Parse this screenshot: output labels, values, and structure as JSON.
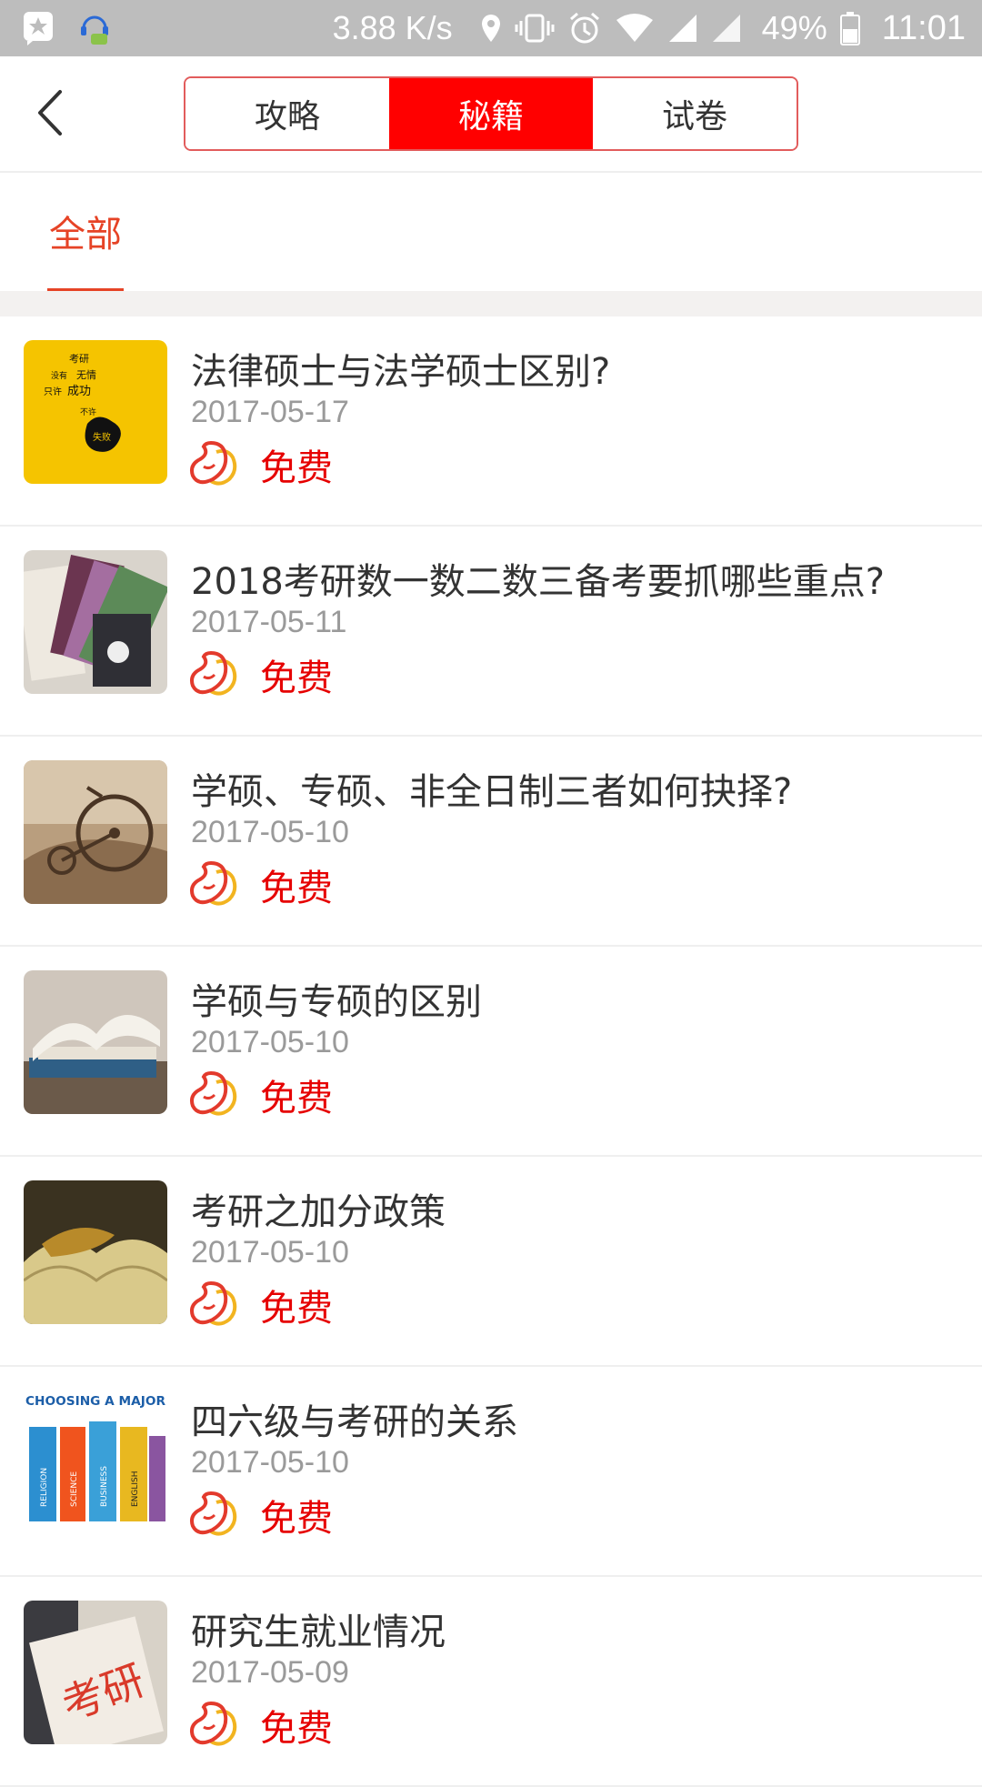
{
  "status_bar": {
    "net_speed": "3.88 K/s",
    "battery": "49%",
    "time": "11:01"
  },
  "header": {
    "tabs": [
      {
        "label": "攻略",
        "active": false
      },
      {
        "label": "秘籍",
        "active": true
      },
      {
        "label": "试卷",
        "active": false
      }
    ]
  },
  "filter": {
    "active_label": "全部"
  },
  "items": [
    {
      "title": "法律硕士与法学硕士区别?",
      "date": "2017-05-17",
      "price": "免费",
      "thumb_icon": "poster-thumbnail"
    },
    {
      "title": "2018考研数一数二数三备考要抓哪些重点?",
      "date": "2017-05-11",
      "price": "免费",
      "thumb_icon": "notebooks-thumbnail"
    },
    {
      "title": "学硕、专硕、非全日制三者如何抉择?",
      "date": "2017-05-10",
      "price": "免费",
      "thumb_icon": "bicycle-book-thumbnail"
    },
    {
      "title": "学硕与专硕的区别",
      "date": "2017-05-10",
      "price": "免费",
      "thumb_icon": "open-book-thumbnail"
    },
    {
      "title": "考研之加分政策",
      "date": "2017-05-10",
      "price": "免费",
      "thumb_icon": "leaf-book-thumbnail"
    },
    {
      "title": "四六级与考研的关系",
      "date": "2017-05-10",
      "price": "免费",
      "thumb_icon": "major-books-thumbnail"
    },
    {
      "title": "研究生就业情况",
      "date": "2017-05-09",
      "price": "免费",
      "thumb_icon": "kaoyan-paper-thumbnail"
    }
  ],
  "thumb_labels": {
    "poster_lines": [
      "考研",
      "没有",
      "无情",
      "只许",
      "成功",
      "不许",
      "失败"
    ],
    "major_caption": "CHOOSING A MAJOR",
    "book_spines": [
      "RELIGION",
      "SCIENCE",
      "BUSINESS",
      "ENGLISH"
    ],
    "paper_text": "考研"
  },
  "colors": {
    "accent": "#ff0000",
    "tab_indicator": "#e64326",
    "price": "#e60000",
    "status_bar": "#bdbdbd"
  }
}
